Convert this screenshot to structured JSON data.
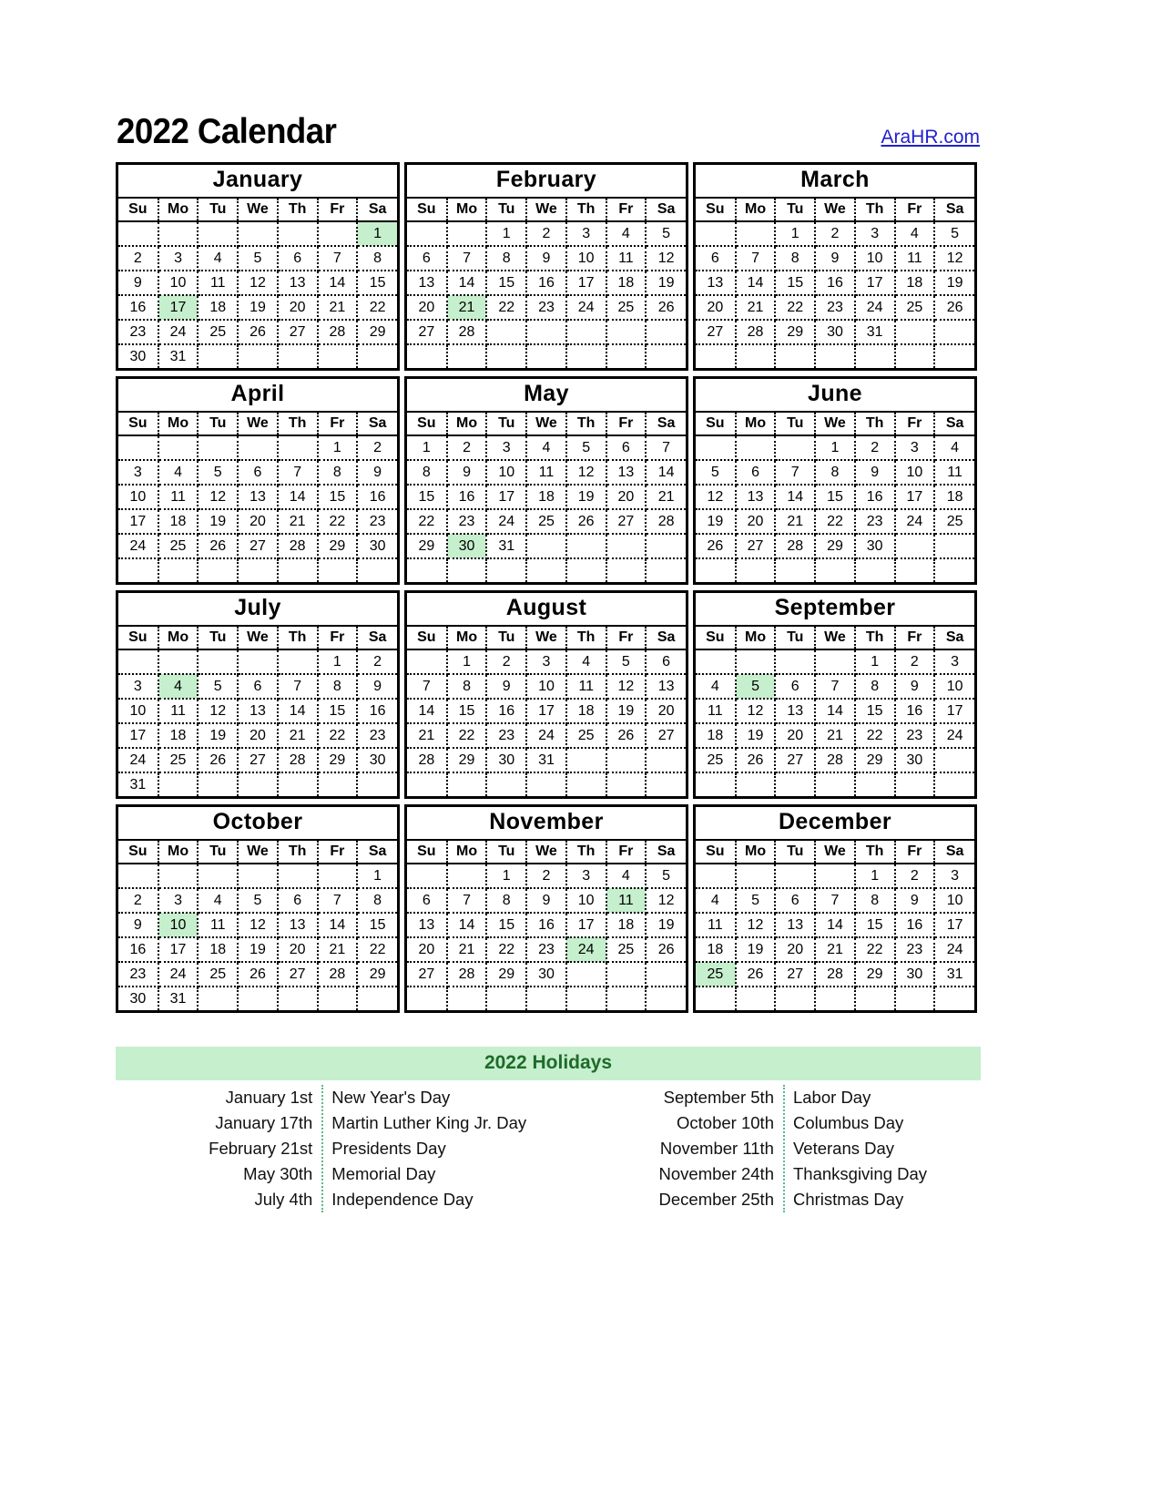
{
  "header": {
    "title": "2022 Calendar",
    "link_label": "AraHR.com",
    "link_color": "#2222cc"
  },
  "colors": {
    "highlight": "#c6efcd",
    "holiday_title": "#1d6b2a",
    "border": "#000000"
  },
  "weekday_headers": [
    "Su",
    "Mo",
    "Tu",
    "We",
    "Th",
    "Fr",
    "Sa"
  ],
  "months": [
    {
      "name": "January",
      "weeks": [
        [
          "",
          "",
          "",
          "",
          "",
          "",
          "1"
        ],
        [
          "2",
          "3",
          "4",
          "5",
          "6",
          "7",
          "8"
        ],
        [
          "9",
          "10",
          "11",
          "12",
          "13",
          "14",
          "15"
        ],
        [
          "16",
          "17",
          "18",
          "19",
          "20",
          "21",
          "22"
        ],
        [
          "23",
          "24",
          "25",
          "26",
          "27",
          "28",
          "29"
        ],
        [
          "30",
          "31",
          "",
          "",
          "",
          "",
          ""
        ]
      ],
      "highlights": [
        "1",
        "17"
      ]
    },
    {
      "name": "February",
      "weeks": [
        [
          "",
          "",
          "1",
          "2",
          "3",
          "4",
          "5"
        ],
        [
          "6",
          "7",
          "8",
          "9",
          "10",
          "11",
          "12"
        ],
        [
          "13",
          "14",
          "15",
          "16",
          "17",
          "18",
          "19"
        ],
        [
          "20",
          "21",
          "22",
          "23",
          "24",
          "25",
          "26"
        ],
        [
          "27",
          "28",
          "",
          "",
          "",
          "",
          ""
        ],
        [
          "",
          "",
          "",
          "",
          "",
          "",
          ""
        ]
      ],
      "highlights": [
        "21"
      ]
    },
    {
      "name": "March",
      "weeks": [
        [
          "",
          "",
          "1",
          "2",
          "3",
          "4",
          "5"
        ],
        [
          "6",
          "7",
          "8",
          "9",
          "10",
          "11",
          "12"
        ],
        [
          "13",
          "14",
          "15",
          "16",
          "17",
          "18",
          "19"
        ],
        [
          "20",
          "21",
          "22",
          "23",
          "24",
          "25",
          "26"
        ],
        [
          "27",
          "28",
          "29",
          "30",
          "31",
          "",
          ""
        ],
        [
          "",
          "",
          "",
          "",
          "",
          "",
          ""
        ]
      ],
      "highlights": []
    },
    {
      "name": "April",
      "weeks": [
        [
          "",
          "",
          "",
          "",
          "",
          "1",
          "2"
        ],
        [
          "3",
          "4",
          "5",
          "6",
          "7",
          "8",
          "9"
        ],
        [
          "10",
          "11",
          "12",
          "13",
          "14",
          "15",
          "16"
        ],
        [
          "17",
          "18",
          "19",
          "20",
          "21",
          "22",
          "23"
        ],
        [
          "24",
          "25",
          "26",
          "27",
          "28",
          "29",
          "30"
        ],
        [
          "",
          "",
          "",
          "",
          "",
          "",
          ""
        ]
      ],
      "highlights": []
    },
    {
      "name": "May",
      "weeks": [
        [
          "1",
          "2",
          "3",
          "4",
          "5",
          "6",
          "7"
        ],
        [
          "8",
          "9",
          "10",
          "11",
          "12",
          "13",
          "14"
        ],
        [
          "15",
          "16",
          "17",
          "18",
          "19",
          "20",
          "21"
        ],
        [
          "22",
          "23",
          "24",
          "25",
          "26",
          "27",
          "28"
        ],
        [
          "29",
          "30",
          "31",
          "",
          "",
          "",
          ""
        ],
        [
          "",
          "",
          "",
          "",
          "",
          "",
          ""
        ]
      ],
      "highlights": [
        "30"
      ]
    },
    {
      "name": "June",
      "weeks": [
        [
          "",
          "",
          "",
          "1",
          "2",
          "3",
          "4"
        ],
        [
          "5",
          "6",
          "7",
          "8",
          "9",
          "10",
          "11"
        ],
        [
          "12",
          "13",
          "14",
          "15",
          "16",
          "17",
          "18"
        ],
        [
          "19",
          "20",
          "21",
          "22",
          "23",
          "24",
          "25"
        ],
        [
          "26",
          "27",
          "28",
          "29",
          "30",
          "",
          ""
        ],
        [
          "",
          "",
          "",
          "",
          "",
          "",
          ""
        ]
      ],
      "highlights": []
    },
    {
      "name": "July",
      "weeks": [
        [
          "",
          "",
          "",
          "",
          "",
          "1",
          "2"
        ],
        [
          "3",
          "4",
          "5",
          "6",
          "7",
          "8",
          "9"
        ],
        [
          "10",
          "11",
          "12",
          "13",
          "14",
          "15",
          "16"
        ],
        [
          "17",
          "18",
          "19",
          "20",
          "21",
          "22",
          "23"
        ],
        [
          "24",
          "25",
          "26",
          "27",
          "28",
          "29",
          "30"
        ],
        [
          "31",
          "",
          "",
          "",
          "",
          "",
          ""
        ]
      ],
      "highlights": [
        "4"
      ]
    },
    {
      "name": "August",
      "weeks": [
        [
          "",
          "1",
          "2",
          "3",
          "4",
          "5",
          "6"
        ],
        [
          "7",
          "8",
          "9",
          "10",
          "11",
          "12",
          "13"
        ],
        [
          "14",
          "15",
          "16",
          "17",
          "18",
          "19",
          "20"
        ],
        [
          "21",
          "22",
          "23",
          "24",
          "25",
          "26",
          "27"
        ],
        [
          "28",
          "29",
          "30",
          "31",
          "",
          "",
          ""
        ],
        [
          "",
          "",
          "",
          "",
          "",
          "",
          ""
        ]
      ],
      "highlights": []
    },
    {
      "name": "September",
      "weeks": [
        [
          "",
          "",
          "",
          "",
          "1",
          "2",
          "3"
        ],
        [
          "4",
          "5",
          "6",
          "7",
          "8",
          "9",
          "10"
        ],
        [
          "11",
          "12",
          "13",
          "14",
          "15",
          "16",
          "17"
        ],
        [
          "18",
          "19",
          "20",
          "21",
          "22",
          "23",
          "24"
        ],
        [
          "25",
          "26",
          "27",
          "28",
          "29",
          "30",
          ""
        ],
        [
          "",
          "",
          "",
          "",
          "",
          "",
          ""
        ]
      ],
      "highlights": [
        "5"
      ]
    },
    {
      "name": "October",
      "weeks": [
        [
          "",
          "",
          "",
          "",
          "",
          "",
          "1"
        ],
        [
          "2",
          "3",
          "4",
          "5",
          "6",
          "7",
          "8"
        ],
        [
          "9",
          "10",
          "11",
          "12",
          "13",
          "14",
          "15"
        ],
        [
          "16",
          "17",
          "18",
          "19",
          "20",
          "21",
          "22"
        ],
        [
          "23",
          "24",
          "25",
          "26",
          "27",
          "28",
          "29"
        ],
        [
          "30",
          "31",
          "",
          "",
          "",
          "",
          ""
        ]
      ],
      "highlights": [
        "10"
      ]
    },
    {
      "name": "November",
      "weeks": [
        [
          "",
          "",
          "1",
          "2",
          "3",
          "4",
          "5"
        ],
        [
          "6",
          "7",
          "8",
          "9",
          "10",
          "11",
          "12"
        ],
        [
          "13",
          "14",
          "15",
          "16",
          "17",
          "18",
          "19"
        ],
        [
          "20",
          "21",
          "22",
          "23",
          "24",
          "25",
          "26"
        ],
        [
          "27",
          "28",
          "29",
          "30",
          "",
          "",
          ""
        ],
        [
          "",
          "",
          "",
          "",
          "",
          "",
          ""
        ]
      ],
      "highlights": [
        "11",
        "24"
      ]
    },
    {
      "name": "December",
      "weeks": [
        [
          "",
          "",
          "",
          "",
          "1",
          "2",
          "3"
        ],
        [
          "4",
          "5",
          "6",
          "7",
          "8",
          "9",
          "10"
        ],
        [
          "11",
          "12",
          "13",
          "14",
          "15",
          "16",
          "17"
        ],
        [
          "18",
          "19",
          "20",
          "21",
          "22",
          "23",
          "24"
        ],
        [
          "25",
          "26",
          "27",
          "28",
          "29",
          "30",
          "31"
        ],
        [
          "",
          "",
          "",
          "",
          "",
          "",
          ""
        ]
      ],
      "highlights": [
        "25"
      ]
    }
  ],
  "holidays": {
    "title": "2022 Holidays",
    "left": [
      {
        "date": "January 1st",
        "name": "New Year's Day"
      },
      {
        "date": "January 17th",
        "name": "Martin Luther King Jr. Day"
      },
      {
        "date": "February 21st",
        "name": "Presidents Day"
      },
      {
        "date": "May 30th",
        "name": "Memorial Day"
      },
      {
        "date": "July 4th",
        "name": "Independence Day"
      }
    ],
    "right": [
      {
        "date": "September 5th",
        "name": "Labor Day"
      },
      {
        "date": "October 10th",
        "name": "Columbus Day"
      },
      {
        "date": "November 11th",
        "name": "Veterans Day"
      },
      {
        "date": "November 24th",
        "name": "Thanksgiving Day"
      },
      {
        "date": "December 25th",
        "name": "Christmas Day"
      }
    ]
  }
}
